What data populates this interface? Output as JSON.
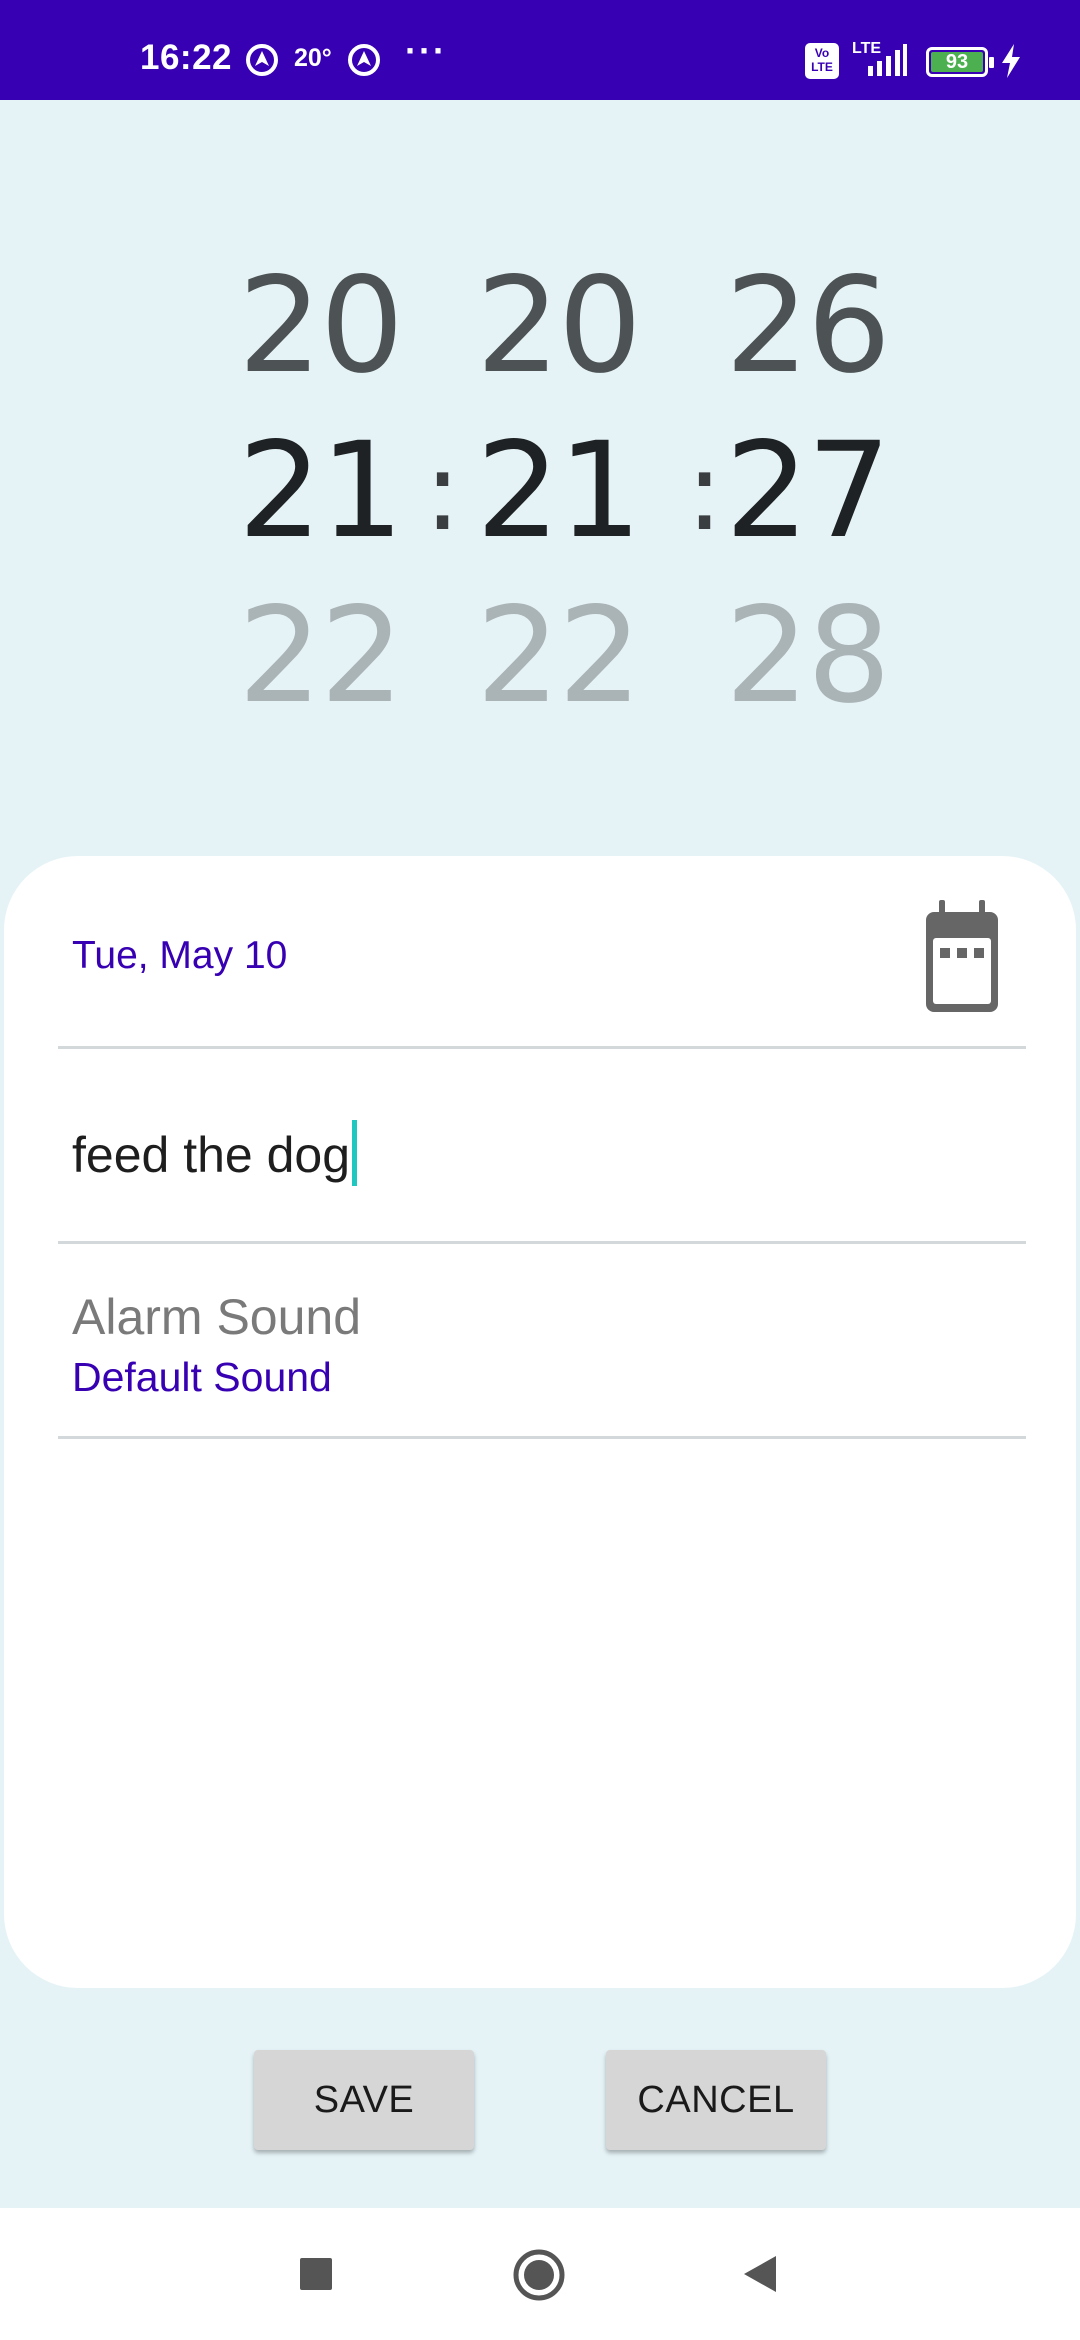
{
  "status_bar": {
    "time": "16:22",
    "temperature": "20°",
    "more_dots": "···",
    "volte_label": "Vo\nLTE",
    "network_label": "LTE",
    "battery_percent": "93",
    "status_bar_color": "#3700b3",
    "icons": [
      "location-icon",
      "location-icon",
      "volte-icon",
      "signal-icon",
      "battery-icon",
      "charging-bolt-icon"
    ]
  },
  "time_picker": {
    "separator": ":",
    "hours": {
      "prev": "20",
      "selected": "21",
      "next": "22"
    },
    "minutes": {
      "prev": "20",
      "selected": "21",
      "next": "22"
    },
    "seconds": {
      "prev": "26",
      "selected": "27",
      "next": "28"
    }
  },
  "form": {
    "date": "Tue, May 10",
    "task_text": "feed the dog",
    "alarm_sound_label": "Alarm Sound",
    "alarm_sound_value": "Default Sound",
    "accent_color": "#3700b3",
    "calendar_icon": "calendar-icon"
  },
  "actions": {
    "save_label": "SAVE",
    "cancel_label": "CANCEL"
  },
  "nav_bar": {
    "icons": [
      "recents-square-icon",
      "home-circle-icon",
      "back-triangle-icon"
    ]
  }
}
